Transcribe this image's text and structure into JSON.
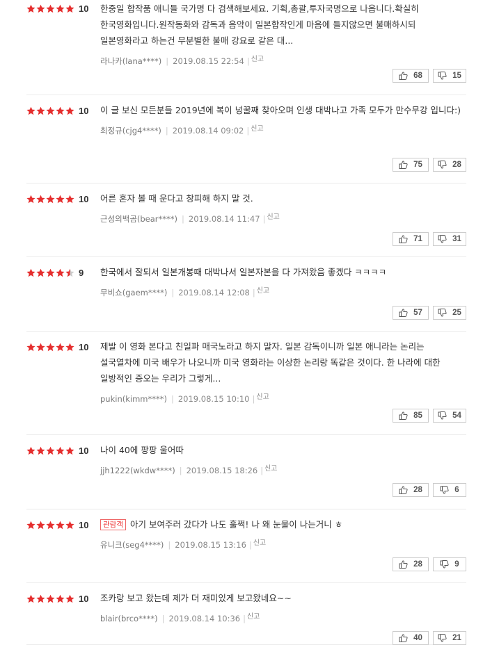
{
  "labels": {
    "report": "신고"
  },
  "colors": {
    "star_filled": "#e52e2e",
    "star_empty": "#cccccc"
  },
  "reviews": [
    {
      "rating": 10,
      "stars": 5,
      "badge": "",
      "text": "한중일 합작품 애니들 국가명 다 검색해보세요. 기획,총괄,투자국명으로 나옵니다.확실히 한국영화입니다.원작동화와 감독과 음악이 일본합작인게 마음에 들지않으면 불매하시되 일본영화라고 하는건 무분별한 불매 강요로 같은 대...",
      "user": "라나카(lana****)",
      "date": "2019.08.15 22:54",
      "likes": "68",
      "dislikes": "15"
    },
    {
      "rating": 10,
      "stars": 5,
      "badge": "",
      "text": "이 글 보신 모든분들 2019년에 복이 넝꿀째 찾아오며 인생 대박나고 가족 모두가 만수무강 입니다:)",
      "user": "최정규(cjg4****)",
      "date": "2019.08.14 09:02",
      "likes": "75",
      "dislikes": "28"
    },
    {
      "rating": 10,
      "stars": 5,
      "badge": "",
      "text": "어른 혼자 볼 때 운다고 창피해 하지 말 것.",
      "user": "근성의백곰(bear****)",
      "date": "2019.08.14 11:47",
      "likes": "71",
      "dislikes": "31"
    },
    {
      "rating": 9,
      "stars": 4.5,
      "badge": "",
      "text": "한국에서 잘되서 일본개봉때 대박나서 일본자본을 다 가져왔음 좋겠다 ㅋㅋㅋㅋ",
      "user": "무비쇼(gaem****)",
      "date": "2019.08.14 12:08",
      "likes": "57",
      "dislikes": "25"
    },
    {
      "rating": 10,
      "stars": 5,
      "badge": "",
      "text": "제발 이 영화 본다고 친일파 매국노라고 하지 말자. 일본 감독이니까 일본 애니라는 논리는 설국열차에 미국 배우가 나오니까 미국 영화라는 이상한 논리랑 똑같은 것이다. 한 나라에 대한 일방적인 증오는 우리가 그렇게...",
      "user": "pukin(kimm****)",
      "date": "2019.08.15 10:10",
      "likes": "85",
      "dislikes": "54"
    },
    {
      "rating": 10,
      "stars": 5,
      "badge": "",
      "text": "나이 40에 팡팡 울어따",
      "user": "jjh1222(wkdw****)",
      "date": "2019.08.15 18:26",
      "likes": "28",
      "dislikes": "6"
    },
    {
      "rating": 10,
      "stars": 5,
      "badge": "관람객",
      "text": "아기 보여주러 갔다가 나도 훌쩍! 나 왜 눈물이 나는거니 ㅎ",
      "user": "유니크(seg4****)",
      "date": "2019.08.15 13:16",
      "likes": "28",
      "dislikes": "9"
    },
    {
      "rating": 10,
      "stars": 5,
      "badge": "",
      "text": "조카랑 보고 왔는데 제가 더 재미있게 보고왔네요~~",
      "user": "blair(brco****)",
      "date": "2019.08.14 10:36",
      "likes": "40",
      "dislikes": "21"
    }
  ]
}
